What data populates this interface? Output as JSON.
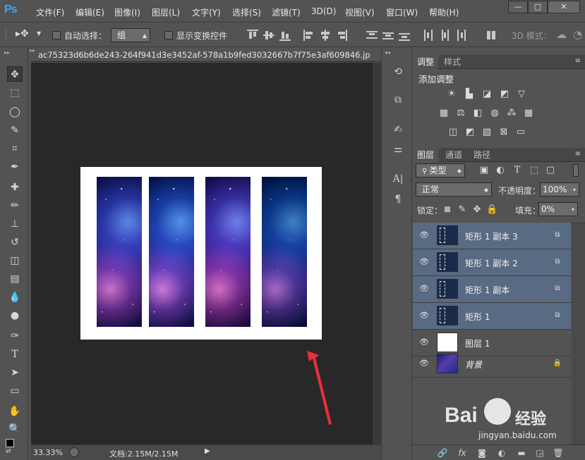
{
  "app": {
    "logo": "Ps"
  },
  "menu": [
    "文件(F)",
    "编辑(E)",
    "图像(I)",
    "图层(L)",
    "文字(Y)",
    "选择(S)",
    "滤镜(T)",
    "3D(D)",
    "视图(V)",
    "窗口(W)",
    "帮助(H)"
  ],
  "window_controls": {
    "minimize": "—",
    "maximize": "□",
    "close": "✕"
  },
  "options": {
    "auto_select_label": "自动选择：",
    "auto_select_value": "组",
    "show_transform_label": "显示变换控件",
    "mode_label": "3D 模式："
  },
  "document": {
    "filename": "ac75323d6b6de243-264f941d3e3452af-578a1b9fed3032667b7f75e3af609846.jp",
    "zoom": "33.33%",
    "doc_info": "文档:2.15M/2.15M"
  },
  "adjustments_panel": {
    "tabs": [
      "调整",
      "样式"
    ],
    "title": "添加调整"
  },
  "layers_panel": {
    "tabs": [
      "图层",
      "通道",
      "路径"
    ],
    "filter_label": "类型",
    "blend_mode": "正常",
    "opacity_label": "不透明度：",
    "opacity_value": "100%",
    "lock_label": "锁定：",
    "fill_label": "填充：",
    "fill_value": "0%",
    "layers": [
      {
        "name": "矩形 1 副本 3",
        "selected": true
      },
      {
        "name": "矩形 1 副本 2",
        "selected": true
      },
      {
        "name": "矩形 1 副本",
        "selected": true
      },
      {
        "name": "矩形 1",
        "selected": true
      },
      {
        "name": "图层 1",
        "selected": false
      },
      {
        "name": "背景",
        "selected": false
      }
    ]
  },
  "watermark": {
    "brand": "Bai",
    "brand2": "经验",
    "url": "jingyan.baidu.com"
  },
  "colors": {
    "selection": "#596a83",
    "arrow": "#e8303a",
    "canvas_bg": "#282828"
  }
}
